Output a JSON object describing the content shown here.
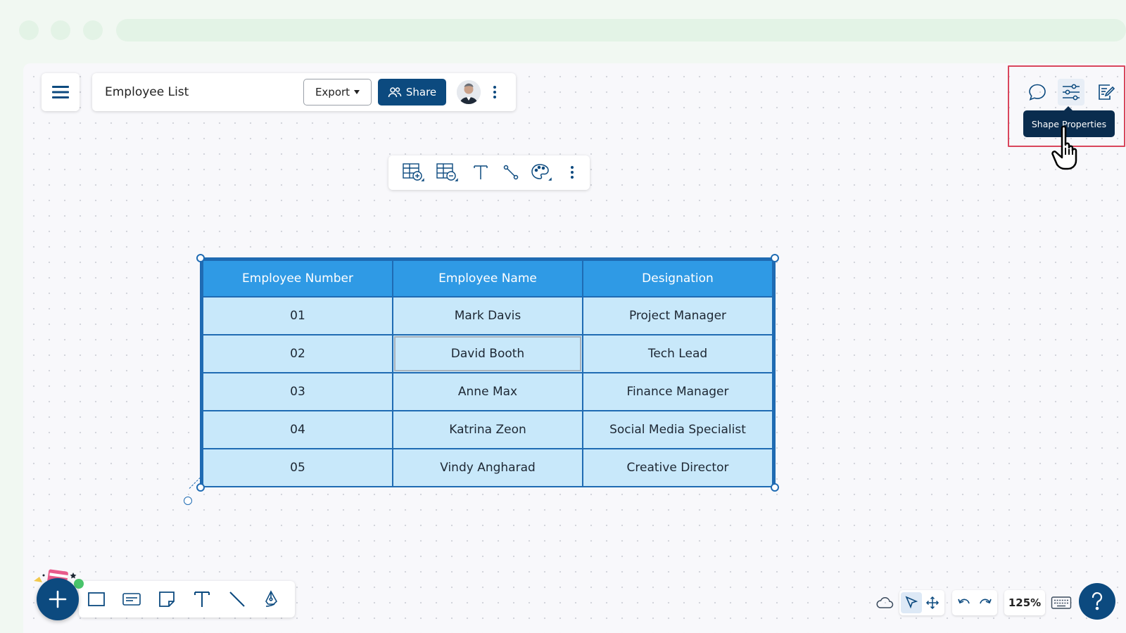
{
  "app": {
    "doc_title": "Employee List"
  },
  "header": {
    "export_label": "Export",
    "share_label": "Share"
  },
  "right_toolbar": {
    "tooltip": "Shape Properties"
  },
  "table": {
    "columns": [
      "Employee Number",
      "Employee Name",
      "Designation"
    ],
    "rows": [
      [
        "01",
        "Mark Davis",
        "Project Manager"
      ],
      [
        "02",
        "David Booth",
        "Tech Lead"
      ],
      [
        "03",
        "Anne Max",
        "Finance Manager"
      ],
      [
        "04",
        "Katrina Zeon",
        "Social Media Specialist"
      ],
      [
        "05",
        "Vindy Angharad",
        "Creative Director"
      ]
    ],
    "selected_cell": "David Booth"
  },
  "bottom_bar": {
    "zoom": "125%"
  },
  "colors": {
    "primary": "#0c4a7f",
    "table_header": "#2f9ae5",
    "table_cell": "#c8e8fa",
    "table_border": "#1f6bb3",
    "highlight": "#d9465c"
  }
}
